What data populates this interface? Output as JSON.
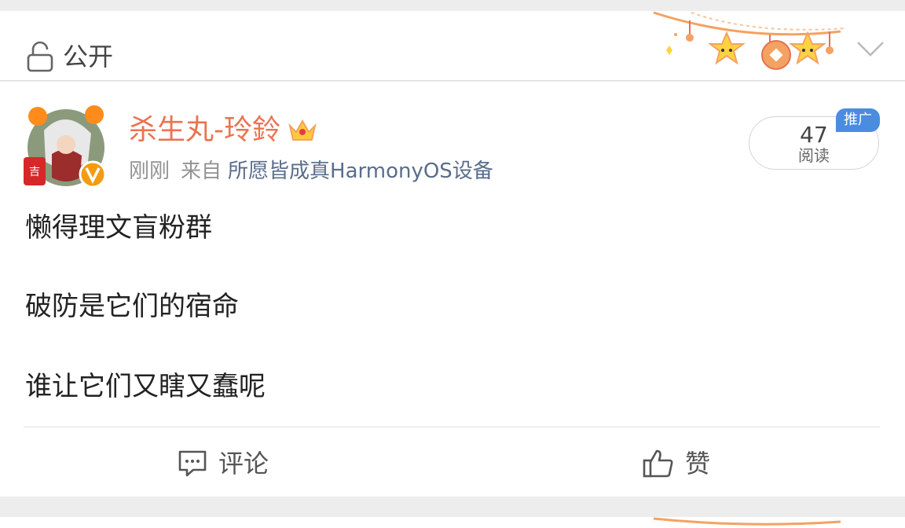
{
  "header": {
    "visibility_label": "公开"
  },
  "post": {
    "username": "杀生丸-玲鈴",
    "time": "刚刚",
    "source_prefix": "来自",
    "device": "所愿皆成真HarmonyOS设备",
    "read_count": "47",
    "read_label": "阅读",
    "promo_badge": "推广",
    "content": [
      "懒得理文盲粉群",
      "破防是它们的宿命",
      "谁让它们又瞎又蠢呢"
    ]
  },
  "actions": {
    "comment_label": "评论",
    "like_label": "赞"
  },
  "icons": {
    "visibility": "lock-open-icon",
    "expand": "chevron-down-icon",
    "comment": "comment-icon",
    "like": "thumbs-up-icon",
    "member": "crown-icon",
    "verified": "verified-v-icon"
  },
  "colors": {
    "username": "#eb7350",
    "device_link": "#5a6d8c",
    "promo": "#4a8ce0",
    "verified": "#f39c12"
  }
}
